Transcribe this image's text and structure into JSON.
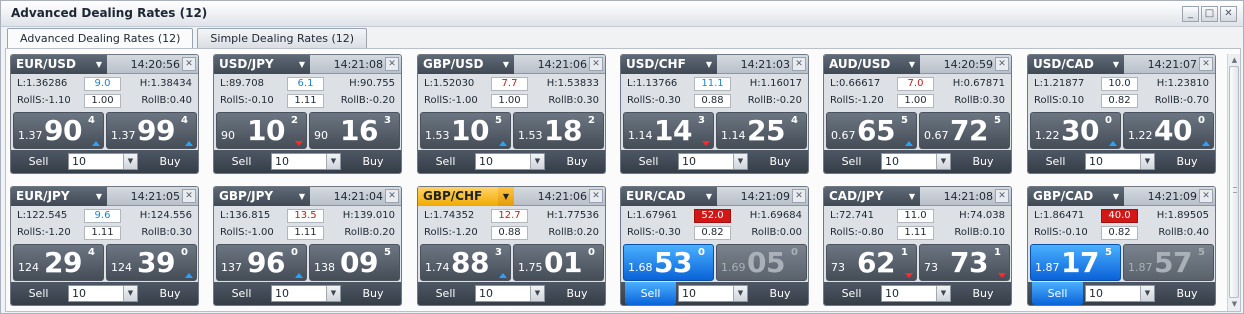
{
  "window": {
    "title": "Advanced Dealing Rates (12)",
    "controls": [
      "_",
      "□",
      "✕"
    ]
  },
  "tabs": [
    {
      "label": "Advanced Dealing Rates (12)",
      "active": true
    },
    {
      "label": "Simple Dealing Rates (12)",
      "active": false
    }
  ],
  "tiles": [
    {
      "pair": "EUR/USD",
      "time": "14:20:56",
      "low": "L:1.36286",
      "high": "H:1.38434",
      "spread": "9.0",
      "spread_style": "blue",
      "rolls": "RollS:-1.10",
      "roll_val": "1.00",
      "rollb": "RollB:0.40",
      "sell": {
        "pre": "1.37",
        "big": "90",
        "sup": "4",
        "arrow": "up"
      },
      "buy": {
        "pre": "1.37",
        "big": "99",
        "sup": "4",
        "arrow": "up"
      },
      "sell_label": "Sell",
      "buy_label": "Buy",
      "amount": "10"
    },
    {
      "pair": "USD/JPY",
      "time": "14:21:08",
      "low": "L:89.708",
      "high": "H:90.755",
      "spread": "6.1",
      "spread_style": "blue",
      "rolls": "RollS:-0.10",
      "roll_val": "1.11",
      "rollb": "RollB:-0.20",
      "sell": {
        "pre": "90",
        "big": "10",
        "sup": "2",
        "arrow": "down"
      },
      "buy": {
        "pre": "90",
        "big": "16",
        "sup": "3",
        "arrow": ""
      },
      "sell_label": "Sell",
      "buy_label": "Buy",
      "amount": "10"
    },
    {
      "pair": "GBP/USD",
      "time": "14:21:06",
      "low": "L:1.52030",
      "high": "H:1.53833",
      "spread": "7.7",
      "spread_style": "red",
      "rolls": "RollS:-1.00",
      "roll_val": "1.00",
      "rollb": "RollB:0.30",
      "sell": {
        "pre": "1.53",
        "big": "10",
        "sup": "5",
        "arrow": "up"
      },
      "buy": {
        "pre": "1.53",
        "big": "18",
        "sup": "2",
        "arrow": ""
      },
      "sell_label": "Sell",
      "buy_label": "Buy",
      "amount": "10"
    },
    {
      "pair": "USD/CHF",
      "time": "14:21:03",
      "low": "L:1.13766",
      "high": "H:1.16017",
      "spread": "11.1",
      "spread_style": "blue",
      "rolls": "RollS:-0.30",
      "roll_val": "0.88",
      "rollb": "RollB:-0.20",
      "sell": {
        "pre": "1.14",
        "big": "14",
        "sup": "3",
        "arrow": "down"
      },
      "buy": {
        "pre": "1.14",
        "big": "25",
        "sup": "4",
        "arrow": ""
      },
      "sell_label": "Sell",
      "buy_label": "Buy",
      "amount": "10"
    },
    {
      "pair": "AUD/USD",
      "time": "14:20:59",
      "low": "L:0.66617",
      "high": "H:0.67871",
      "spread": "7.0",
      "spread_style": "red",
      "rolls": "RollS:-1.20",
      "roll_val": "1.00",
      "rollb": "RollB:0.30",
      "sell": {
        "pre": "0.67",
        "big": "65",
        "sup": "5",
        "arrow": "up"
      },
      "buy": {
        "pre": "0.67",
        "big": "72",
        "sup": "5",
        "arrow": ""
      },
      "sell_label": "Sell",
      "buy_label": "Buy",
      "amount": "10"
    },
    {
      "pair": "USD/CAD",
      "time": "14:21:07",
      "low": "L:1.21877",
      "high": "H:1.23810",
      "spread": "10.0",
      "spread_style": "",
      "rolls": "RollS:0.10",
      "roll_val": "0.82",
      "rollb": "RollB:-0.70",
      "sell": {
        "pre": "1.22",
        "big": "30",
        "sup": "0",
        "arrow": "up"
      },
      "buy": {
        "pre": "1.22",
        "big": "40",
        "sup": "0",
        "arrow": "up"
      },
      "sell_label": "Sell",
      "buy_label": "Buy",
      "amount": "10"
    },
    {
      "pair": "EUR/JPY",
      "time": "14:21:05",
      "low": "L:122.545",
      "high": "H:124.556",
      "spread": "9.6",
      "spread_style": "blue",
      "rolls": "RollS:-1.20",
      "roll_val": "1.11",
      "rollb": "RollB:0.30",
      "sell": {
        "pre": "124",
        "big": "29",
        "sup": "4",
        "arrow": ""
      },
      "buy": {
        "pre": "124",
        "big": "39",
        "sup": "0",
        "arrow": "up"
      },
      "sell_label": "Sell",
      "buy_label": "Buy",
      "amount": "10"
    },
    {
      "pair": "GBP/JPY",
      "time": "14:21:04",
      "low": "L:136.815",
      "high": "H:139.010",
      "spread": "13.5",
      "spread_style": "red",
      "rolls": "RollS:-1.00",
      "roll_val": "1.11",
      "rollb": "RollB:0.20",
      "sell": {
        "pre": "137",
        "big": "96",
        "sup": "0",
        "arrow": "up"
      },
      "buy": {
        "pre": "138",
        "big": "09",
        "sup": "5",
        "arrow": ""
      },
      "sell_label": "Sell",
      "buy_label": "Buy",
      "amount": "10"
    },
    {
      "pair": "GBP/CHF",
      "time": "14:21:06",
      "low": "L:1.74352",
      "high": "H:1.77536",
      "spread": "12.7",
      "spread_style": "red",
      "rolls": "RollS:-1.20",
      "roll_val": "0.88",
      "rollb": "RollB:0.20",
      "highlight": true,
      "sell": {
        "pre": "1.74",
        "big": "88",
        "sup": "3",
        "arrow": "up"
      },
      "buy": {
        "pre": "1.75",
        "big": "01",
        "sup": "0",
        "arrow": ""
      },
      "sell_label": "Sell",
      "buy_label": "Buy",
      "amount": "10"
    },
    {
      "pair": "EUR/CAD",
      "time": "14:21:09",
      "low": "L:1.67961",
      "high": "H:1.69684",
      "spread": "52.0",
      "spread_style": "redbg",
      "rolls": "RollS:-0.30",
      "roll_val": "0.82",
      "rollb": "RollB:0.00",
      "sell": {
        "pre": "1.68",
        "big": "53",
        "sup": "0",
        "arrow": "",
        "state": "blue"
      },
      "buy": {
        "pre": "1.69",
        "big": "05",
        "sup": "0",
        "arrow": "",
        "state": "dis"
      },
      "sell_label": "Sell",
      "buy_label": "Buy",
      "amount": "10",
      "sell_active": true
    },
    {
      "pair": "CAD/JPY",
      "time": "14:21:08",
      "low": "L:72.741",
      "high": "H:74.038",
      "spread": "11.0",
      "spread_style": "",
      "rolls": "RollS:-0.80",
      "roll_val": "1.11",
      "rollb": "RollB:0.10",
      "sell": {
        "pre": "73",
        "big": "62",
        "sup": "1",
        "arrow": "down"
      },
      "buy": {
        "pre": "73",
        "big": "73",
        "sup": "1",
        "arrow": "down"
      },
      "sell_label": "Sell",
      "buy_label": "Buy",
      "amount": "10"
    },
    {
      "pair": "GBP/CAD",
      "time": "14:21:09",
      "low": "L:1.86471",
      "high": "H:1.89505",
      "spread": "40.0",
      "spread_style": "redbg",
      "rolls": "RollS:-0.10",
      "roll_val": "0.82",
      "rollb": "RollB:0.40",
      "sell": {
        "pre": "1.87",
        "big": "17",
        "sup": "5",
        "arrow": "",
        "state": "blue"
      },
      "buy": {
        "pre": "1.87",
        "big": "57",
        "sup": "5",
        "arrow": "",
        "state": "dis"
      },
      "sell_label": "Sell",
      "buy_label": "Buy",
      "amount": "10",
      "sell_active": true
    }
  ]
}
